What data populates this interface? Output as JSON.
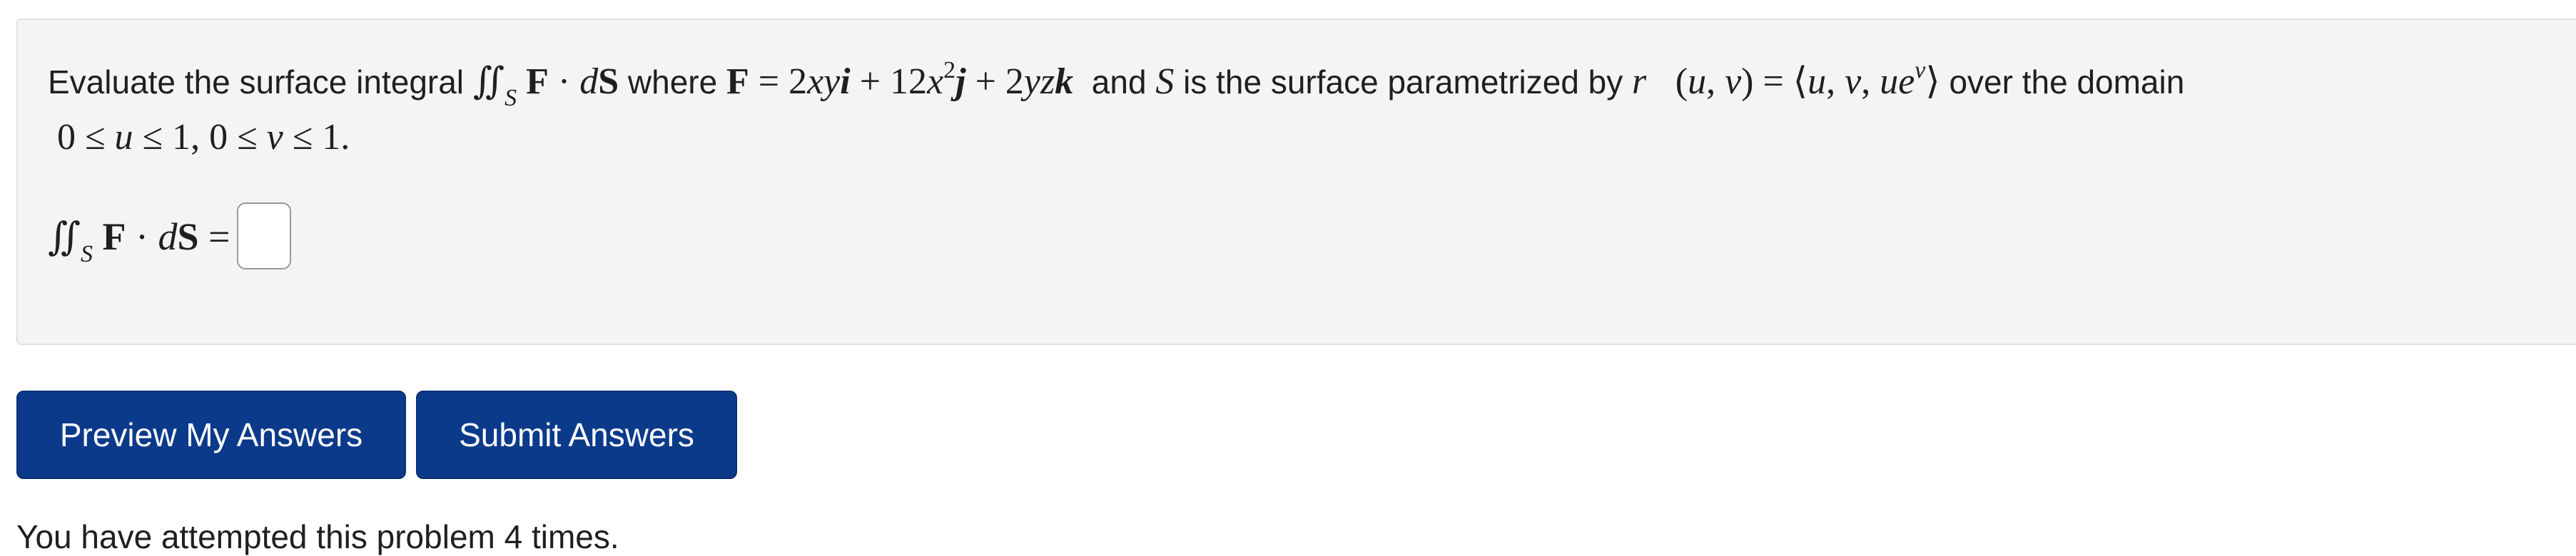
{
  "problem": {
    "text_part1": "Evaluate the surface integral",
    "text_part2": "where",
    "text_part3": "and",
    "text_part4": "is the surface parametrized by",
    "text_part5": "over the domain",
    "integral_symbol": "∬",
    "integral_sub": "S",
    "F_letter": "F",
    "dot": "·",
    "dS": "dS",
    "eq": "=",
    "vector_field_rhs": "2xyi + 12x²j + 2yzk",
    "surface_letter": "S",
    "param_lhs": "r⃗(u, v)",
    "param_rhs": "⟨u, v, ue^v⟩",
    "domain": "0 ≤ u ≤ 1, 0 ≤ v ≤ 1."
  },
  "answer": {
    "prompt": "∬S F · dS =",
    "value": ""
  },
  "buttons": {
    "preview_label": "Preview My Answers",
    "submit_label": "Submit Answers"
  },
  "status": {
    "attempts_text": "You have attempted this problem 4 times."
  },
  "colors": {
    "button_bg": "#0c3a8b",
    "panel_bg": "#f4f4f4"
  }
}
